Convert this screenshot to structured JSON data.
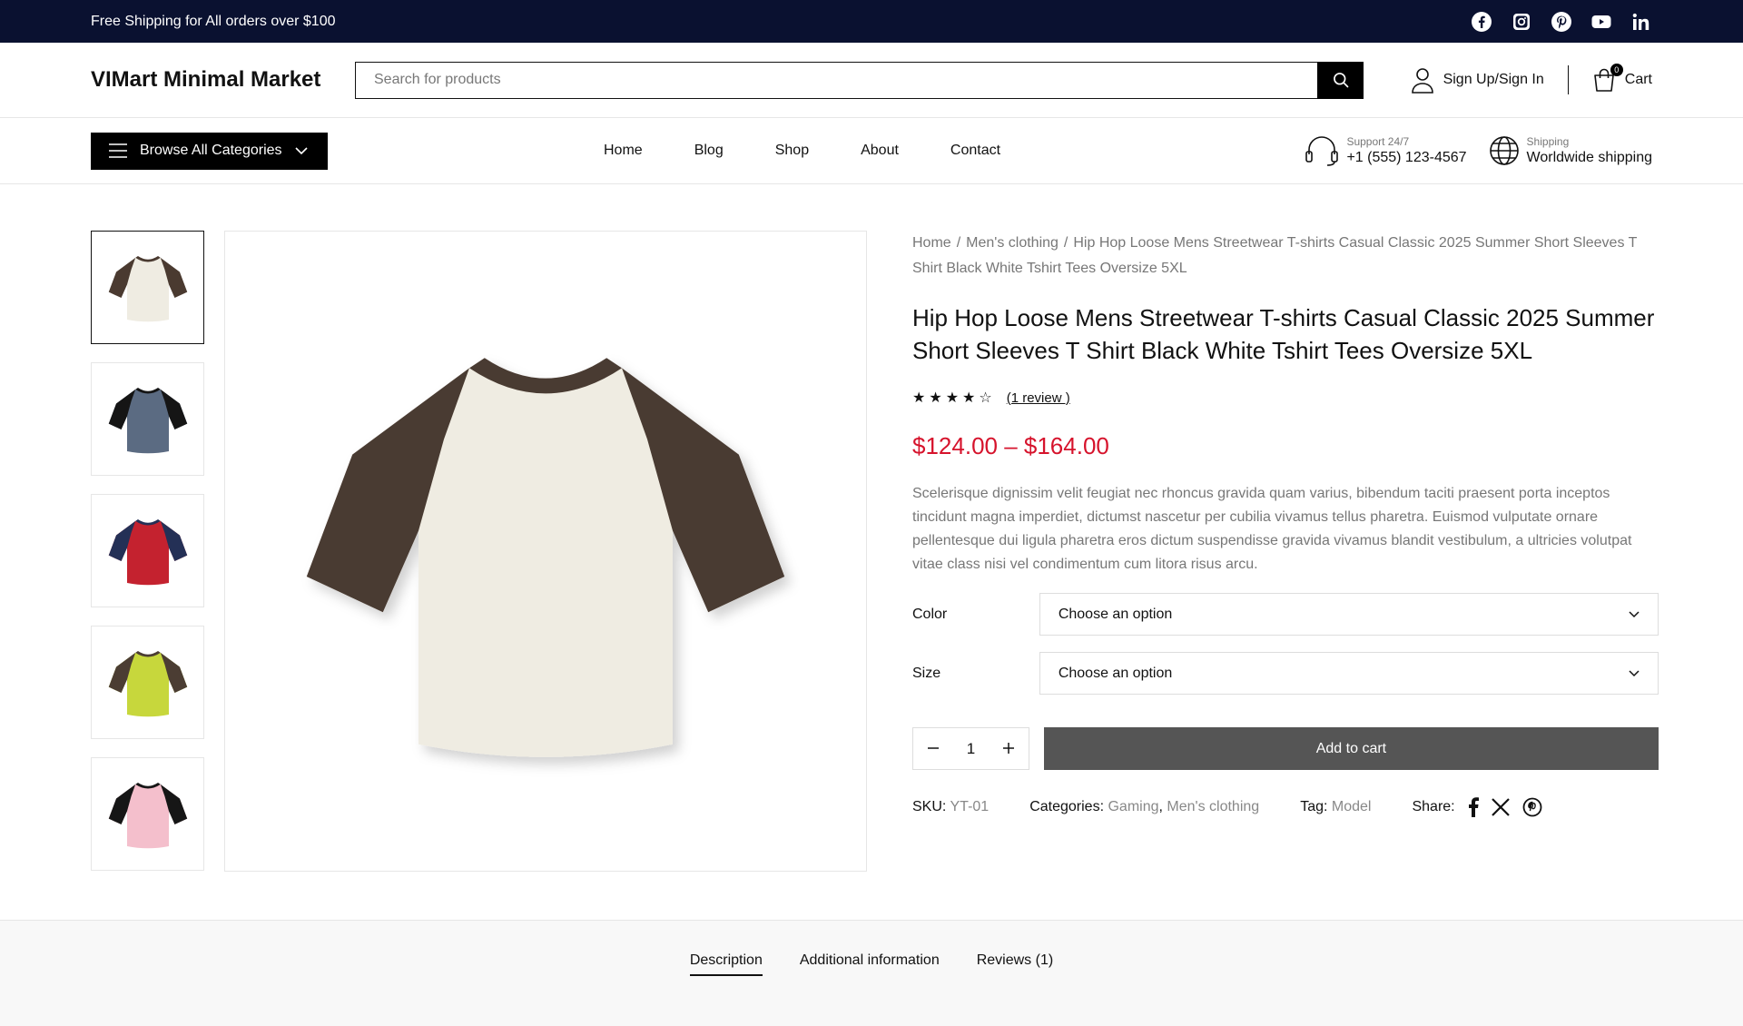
{
  "topbar": {
    "promo": "Free Shipping for All orders over $100",
    "social": [
      "facebook-icon",
      "instagram-icon",
      "pinterest-icon",
      "youtube-icon",
      "linkedin-icon"
    ]
  },
  "header": {
    "logo": "VIMart Minimal Market",
    "search_placeholder": "Search for products",
    "account_label": "Sign Up/Sign In",
    "cart_label": "Cart",
    "cart_count": "0"
  },
  "nav": {
    "browse_label": "Browse All Categories",
    "menu": [
      "Home",
      "Blog",
      "Shop",
      "About",
      "Contact"
    ],
    "support_small": "Support 24/7",
    "support_phone": "+1 (555) 123-4567",
    "shipping_small": "Shipping",
    "shipping_text": "Worldwide shipping"
  },
  "product": {
    "breadcrumb": [
      "Home",
      "Men's clothing",
      "Hip Hop Loose Mens Streetwear T-shirts Casual Classic 2025 Summer Short Sleeves T Shirt Black White Tshirt Tees Oversize 5XL"
    ],
    "title": "Hip Hop Loose Mens Streetwear T-shirts Casual Classic 2025 Summer Short Sleeves T Shirt Black White Tshirt Tees Oversize 5XL",
    "rating": 4,
    "rating_max": 5,
    "review_link": "(1 review )",
    "price": "$124.00 – $164.00",
    "description": "Scelerisque dignissim velit feugiat nec rhoncus gravida quam varius, bibendum taciti praesent porta inceptos tincidunt magna imperdiet, dictumst nascetur per cubilia vivamus tellus pharetra. Euismod vulputate ornare pellentesque dui ligula pharetra eros dictum suspendisse gravida vivamus blandit vestibulum, a ultricies volutpat vitae class nisi vel condimentum cum litora risus arcu.",
    "color_label": "Color",
    "color_value": "Choose an option",
    "size_label": "Size",
    "size_value": "Choose an option",
    "quantity": "1",
    "add_to_cart": "Add to cart",
    "sku_label": "SKU:",
    "sku": "YT-01",
    "categories_label": "Categories:",
    "category_1": "Gaming",
    "category_sep": ",",
    "category_2": "Men's clothing",
    "tag_label": "Tag:",
    "tag": "Model",
    "share_label": "Share:"
  },
  "thumbnails": [
    {
      "body": "#efece2",
      "sleeve": "#4a3a30",
      "active": true
    },
    {
      "body": "#5b6b82",
      "sleeve": "#151515",
      "active": false
    },
    {
      "body": "#c4222f",
      "sleeve": "#243056",
      "active": false
    },
    {
      "body": "#c7d73c",
      "sleeve": "#4b3d33",
      "active": false
    },
    {
      "body": "#f4bfcc",
      "sleeve": "#161616",
      "active": false
    }
  ],
  "tabs": [
    "Description",
    "Additional information",
    "Reviews (1)"
  ],
  "colors": {
    "topbar_bg": "#0a1130",
    "price": "#d6132c",
    "add_to_cart_bg": "#555555"
  }
}
